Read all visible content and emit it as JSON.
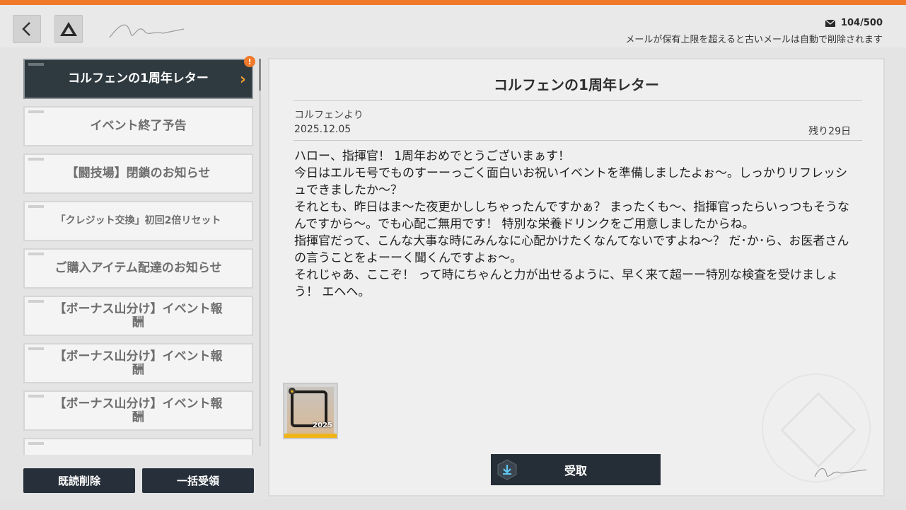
{
  "header": {
    "back_icon": "chevron-left-icon",
    "drive_icon": "triangle-drive-icon",
    "mail_count": "104/500",
    "mail_notice": "メールが保有上限を超えると古いメールは自動で削除されます",
    "accent": "#f07a2a"
  },
  "mail_list": {
    "items": [
      {
        "label": "コルフェンの1周年レター",
        "active": true,
        "alert": "!"
      },
      {
        "label": "イベント終了予告"
      },
      {
        "label": "【闘技場】閉鎖のお知らせ"
      },
      {
        "label": "「クレジット交換」初回2倍リセット"
      },
      {
        "label": "ご購入アイテム配達のお知らせ"
      },
      {
        "label": "【ボーナス山分け】イベント報酬"
      },
      {
        "label": "【ボーナス山分け】イベント報酬"
      },
      {
        "label": "【ボーナス山分け】イベント報酬"
      },
      {
        "label": ""
      }
    ],
    "delete_read_label": "既読削除",
    "receive_all_label": "一括受領"
  },
  "mail": {
    "title": "コルフェンの1周年レター",
    "sender": "コルフェンより",
    "date": "2025.12.05",
    "remaining": "残り29日",
    "body": [
      "ハロー、指揮官！ 1周年おめでとうございまぁす！",
      "今日はエルモ号でものすーーっごく面白いお祝いイベントを準備しましたよぉ〜。しっかりリフレッシュできましたか〜？",
      "それとも、昨日はま〜た夜更かししちゃったんですかぁ？ まったくも〜、指揮官ったらいっつもそうなんですから〜。でも心配ご無用です！ 特別な栄養ドリンクをご用意しましたからね。",
      "指揮官だって、こんな大事な時にみんなに心配かけたくなんてないですよね〜？ だ･か･ら、お医者さんの言うことをよーーく聞くんですよぉ〜。",
      "それじゃあ、ここぞ！ って時にちゃんと力が出せるように、早く来て超ーー特別な検査を受けましょう！ エヘヘ。"
    ],
    "reward": {
      "icon": "frame-item-icon",
      "year": "2025"
    },
    "claim_label": "受取",
    "claim_icon": "download-icon"
  }
}
